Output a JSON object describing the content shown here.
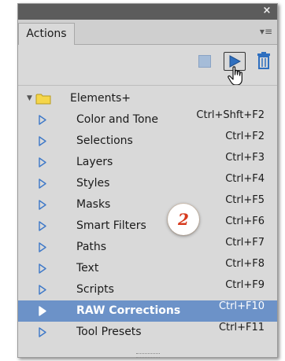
{
  "panel": {
    "close_glyph": "×",
    "tab_label": "Actions",
    "menu_glyph": "▾≡"
  },
  "toolbar": {
    "icons": [
      "stop-icon",
      "play-icon",
      "trash-icon",
      "hand-cursor-icon"
    ]
  },
  "colors": {
    "selected_row": "#6c92c8",
    "triangle": "#3d78c8",
    "folder": "#f5d64a",
    "badge_text": "#d73a1e"
  },
  "actions": {
    "folder": {
      "label": "Elements+",
      "expander": "▼"
    },
    "items": [
      {
        "label": "Color and Tone",
        "shortcut": "Ctrl+Shft+F2"
      },
      {
        "label": "Selections",
        "shortcut": "Ctrl+F2"
      },
      {
        "label": "Layers",
        "shortcut": "Ctrl+F3"
      },
      {
        "label": "Styles",
        "shortcut": "Ctrl+F4"
      },
      {
        "label": "Masks",
        "shortcut": "Ctrl+F5"
      },
      {
        "label": "Smart Filters",
        "shortcut": "Ctrl+F6"
      },
      {
        "label": "Paths",
        "shortcut": "Ctrl+F7"
      },
      {
        "label": "Text",
        "shortcut": "Ctrl+F8"
      },
      {
        "label": "Scripts",
        "shortcut": "Ctrl+F9"
      },
      {
        "label": "RAW Corrections",
        "shortcut": "Ctrl+F10",
        "selected": true
      },
      {
        "label": "Tool Presets",
        "shortcut": "Ctrl+F11"
      }
    ]
  },
  "annotation": {
    "badge_text": "2"
  }
}
